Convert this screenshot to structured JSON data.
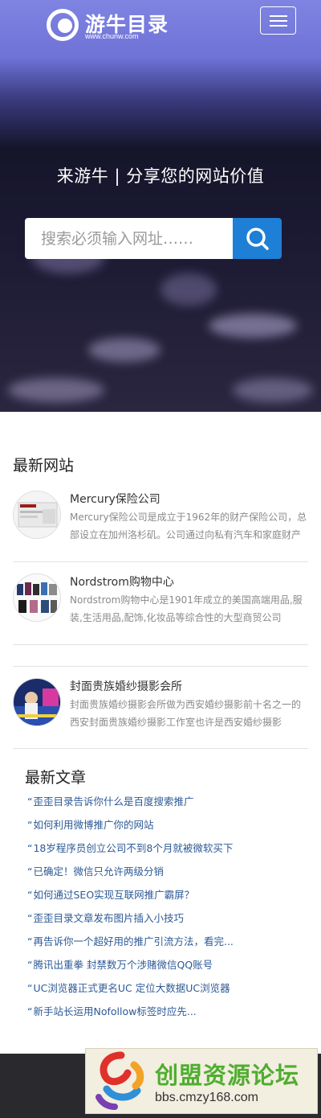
{
  "header": {
    "logo_text": "游牛目录",
    "logo_sub": "www.chunw.com",
    "tagline": "来游牛 | 分享您的网站价值"
  },
  "search": {
    "placeholder": "搜索必须输入网址……"
  },
  "new_sites": {
    "title": "最新网站",
    "items": [
      {
        "name": "Mercury保险公司",
        "desc": "Mercury保险公司是成立于1962年的财产保险公司，总部设立在加州洛杉矶。公司通过向私有汽车和家庭财产提供保险服务"
      },
      {
        "name": "Nordstrom购物中心",
        "desc": "Nordstrom购物中心是1901年成立的美国高端用品,服装,生活用品,配饰,化妆品等综合性的大型商贸公司"
      },
      {
        "name": "封面贵族婚纱摄影会所",
        "desc": "封面贵族婚纱摄影会所做为西安婚纱摄影前十名之一的西安封面贵族婚纱摄影工作室也许是西安婚纱摄影"
      }
    ]
  },
  "articles": {
    "title": "最新文章",
    "items": [
      "歪歪目录告诉你什么是百度搜索推广",
      "如何利用微博推广你的网站",
      "18岁程序员创立公司不到8个月就被微软买下",
      "已确定！微信只允许两级分销",
      "如何通过SEO实现互联网推广霸屏？",
      "歪歪目录文章发布图片插入小技巧",
      "再告诉你一个超好用的推广引流方法，看完...",
      "腾讯出重拳 封禁数万个涉赌微信QQ账号",
      "UC浏览器正式更名UC 定位大数据UC浏览器",
      "新手站长运用Nofollow标签时应先..."
    ]
  },
  "watermark": {
    "text": "创盟资源论坛",
    "url": "bbs.cmzy168.com"
  },
  "colors": {
    "accent": "#1e7fd6",
    "link": "#2d5a96",
    "watermark_green": "#4fae2f"
  }
}
